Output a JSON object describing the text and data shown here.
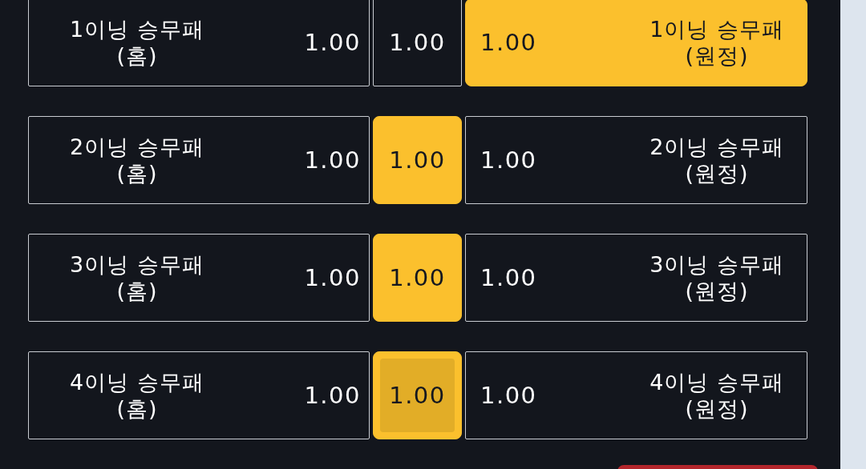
{
  "markets": [
    {
      "home": {
        "title": "1이닝 승무패",
        "side": "(홈)",
        "odds": "1.00",
        "selected": false,
        "pressed": false
      },
      "draw": {
        "odds": "1.00",
        "selected": false,
        "pressed": false
      },
      "away": {
        "title": "1이닝 승무패",
        "side": "(원정)",
        "odds": "1.00",
        "selected": true,
        "pressed": false
      }
    },
    {
      "home": {
        "title": "2이닝 승무패",
        "side": "(홈)",
        "odds": "1.00",
        "selected": false,
        "pressed": false
      },
      "draw": {
        "odds": "1.00",
        "selected": true,
        "pressed": false
      },
      "away": {
        "title": "2이닝 승무패",
        "side": "(원정)",
        "odds": "1.00",
        "selected": false,
        "pressed": false
      }
    },
    {
      "home": {
        "title": "3이닝 승무패",
        "side": "(홈)",
        "odds": "1.00",
        "selected": false,
        "pressed": false
      },
      "draw": {
        "odds": "1.00",
        "selected": true,
        "pressed": false
      },
      "away": {
        "title": "3이닝 승무패",
        "side": "(원정)",
        "odds": "1.00",
        "selected": false,
        "pressed": false
      }
    },
    {
      "home": {
        "title": "4이닝 승무패",
        "side": "(홈)",
        "odds": "1.00",
        "selected": false,
        "pressed": false
      },
      "draw": {
        "odds": "1.00",
        "selected": true,
        "pressed": true
      },
      "away": {
        "title": "4이닝 승무패",
        "side": "(원정)",
        "odds": "1.00",
        "selected": false,
        "pressed": false
      }
    }
  ]
}
